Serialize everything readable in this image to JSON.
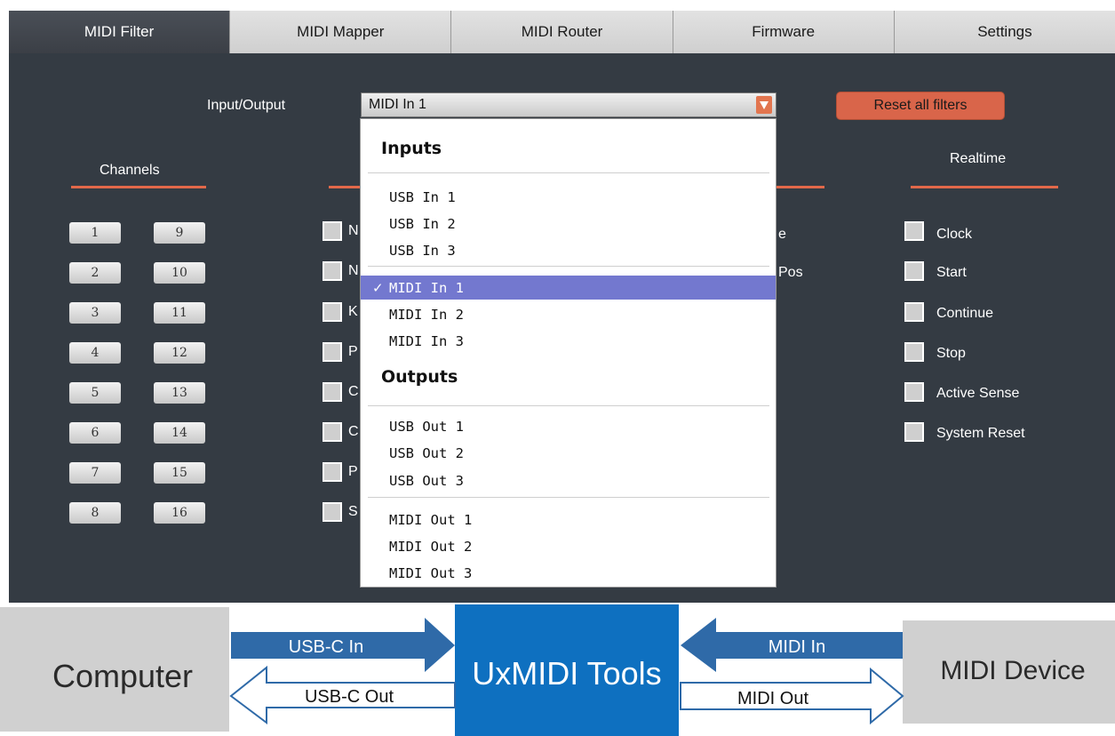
{
  "tabs": [
    {
      "label": "MIDI Filter",
      "active": true
    },
    {
      "label": "MIDI Mapper",
      "active": false
    },
    {
      "label": "MIDI Router",
      "active": false
    },
    {
      "label": "Firmware",
      "active": false
    },
    {
      "label": "Settings",
      "active": false
    }
  ],
  "io": {
    "label": "Input/Output",
    "selected_value": "MIDI In 1"
  },
  "reset_button": "Reset all filters",
  "sections": {
    "channels": "Channels",
    "realtime": "Realtime"
  },
  "channels": [
    "1",
    "2",
    "3",
    "4",
    "5",
    "6",
    "7",
    "8",
    "9",
    "10",
    "11",
    "12",
    "13",
    "14",
    "15",
    "16"
  ],
  "middle_partials": [
    "N",
    "N",
    "K",
    "P",
    "C",
    "C",
    "P",
    "S"
  ],
  "right_partials": [
    "e",
    "Pos"
  ],
  "realtime": [
    "Clock",
    "Start",
    "Continue",
    "Stop",
    "Active Sense",
    "System Reset"
  ],
  "dropdown": {
    "inputs_heading": "Inputs",
    "outputs_heading": "Outputs",
    "check_mark": "✓",
    "items": [
      "USB In 1",
      "USB In 2",
      "USB In 3",
      "MIDI In 1",
      "MIDI In 2",
      "MIDI In 3",
      "USB Out 1",
      "USB Out 2",
      "USB Out 3",
      "MIDI Out 1",
      "MIDI Out 2",
      "MIDI Out 3"
    ],
    "selected_item": "MIDI In 1"
  },
  "diagram": {
    "computer": "Computer",
    "center": "UxMIDI Tools",
    "device": "MIDI Device",
    "usb_in": "USB-C In",
    "usb_out": "USB-C Out",
    "midi_in": "MIDI In",
    "midi_out": "MIDI Out"
  },
  "colors": {
    "panel": "#343b43",
    "accent": "#e2684a",
    "selection": "#7378cf",
    "diagram_blue": "#0e70c0",
    "diagram_arrow": "#2f6aa8",
    "diagram_grey": "#d0d0d0"
  }
}
